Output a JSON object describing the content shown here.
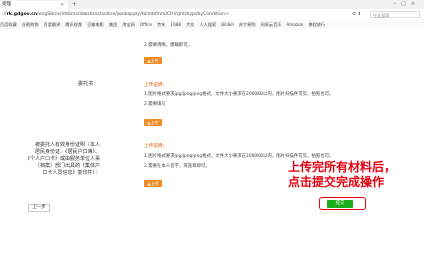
{
  "browser": {
    "tab_title": "受理",
    "url_prefix": "://",
    "url_host": "rk.gdgov.cn",
    "url_path": "/engSbms/ldsbms/ldwsbms/online/jwebapply/tolmbf/nmlCtrl/sjht/bypsbyCondition>",
    "search_placeholder": "在此搜索",
    "bookmarks": [
      "百度收藏",
      "谷歌购物",
      "百度翻译",
      "腾讯视频",
      "豆瓣电影",
      "美团",
      "淘宝网",
      "Office",
      "京东",
      "1688",
      "大众",
      "人人搜索",
      "Bilibili",
      "苏宁易购",
      "网易云音乐",
      "Amazon",
      "携程旅行"
    ]
  },
  "form": {
    "section1_note": "2.需要清晰，模糊即可。",
    "upload_label": "上传",
    "field2_label": "委托书：",
    "field2_hint_title": "上传说明：",
    "field2_hint_1": "1.图片格式要求jpg/jpeg/png格式，文件大小要求在2000KB以内，图片扫描件可见，拍照也可。",
    "field2_hint_2": "2.需要填写",
    "field3_label_lines": [
      "被委托人有效身份证明（本人",
      "居民身份证、《居民户口簿》、",
      "《个人户口卡》或由服务单位人事",
      "（档案）部门出具的《集体户",
      "口卡人员信息》复印件）："
    ],
    "field3_hint_title": "上传说明：",
    "field3_hint_1": "1.图片格式要求jpg/jpeg/png格式，文件大小要求在2000KB以内，图片扫描件可见，拍照也可。",
    "field3_hint_2": "2.需要在本人签字，或盖章即可。",
    "prev_button": "上一步",
    "submit_button": "提交"
  },
  "annotation": {
    "line1": "上传完所有材料后，",
    "line2": "点击提交完成操作"
  },
  "colors": {
    "accent": "#f08a22",
    "submit": "#1aad19",
    "annotation": "#e60012"
  }
}
